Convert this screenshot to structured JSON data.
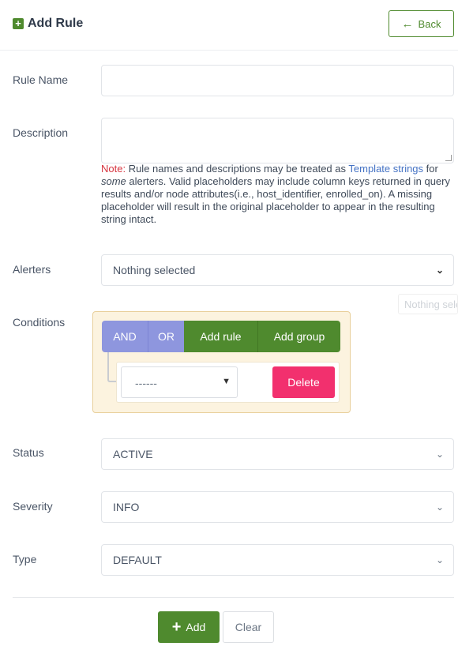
{
  "header": {
    "title": "Add Rule",
    "back_label": "Back",
    "title_icon": "plus-square-icon",
    "back_icon": "arrow-left-icon"
  },
  "form": {
    "rule_name": {
      "label": "Rule Name",
      "value": ""
    },
    "description": {
      "label": "Description",
      "value": ""
    },
    "note": {
      "prefix": "Note:",
      "text1": " Rule names and descriptions may be treated as ",
      "link": "Template strings",
      "text2": " for ",
      "emphasis": "some",
      "text3": " alerters. Valid placeholders may include column keys returned in query results and/or node attributes(i.e., host_identifier, enrolled_on). A missing placeholder will result in the original placeholder to appear in the resulting string intact."
    },
    "alerters": {
      "label": "Alerters",
      "value": "Nothing selected",
      "ghost_text": "Nothing selected"
    },
    "conditions": {
      "label": "Conditions",
      "and_label": "AND",
      "or_label": "OR",
      "add_rule_label": "Add rule",
      "add_group_label": "Add group",
      "rule_select_value": "------",
      "delete_label": "Delete"
    },
    "status": {
      "label": "Status",
      "value": "ACTIVE"
    },
    "severity": {
      "label": "Severity",
      "value": "INFO"
    },
    "type": {
      "label": "Type",
      "value": "DEFAULT"
    }
  },
  "actions": {
    "add_label": "Add",
    "clear_label": "Clear"
  },
  "colors": {
    "primary_green": "#4f8a2e",
    "condition_purple": "#8e96de",
    "delete_pink": "#f2306e",
    "note_red": "#d6343f",
    "link_blue": "#4472c4",
    "conditions_bg": "#fcf3df"
  }
}
